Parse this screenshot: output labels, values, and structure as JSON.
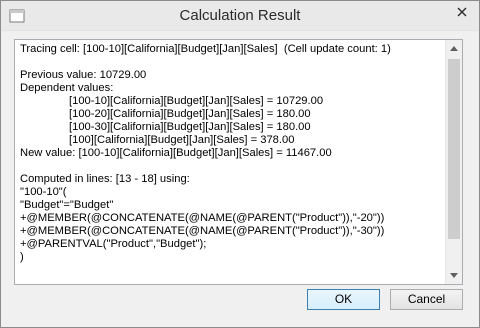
{
  "window": {
    "title": "Calculation Result"
  },
  "content": {
    "lines": [
      {
        "text": "Tracing cell: [100-10][California][Budget][Jan][Sales]  (Cell update count: 1)",
        "indent": false
      },
      {
        "text": "",
        "indent": false
      },
      {
        "text": "Previous value: 10729.00",
        "indent": false
      },
      {
        "text": "Dependent values:",
        "indent": false
      },
      {
        "text": "[100-10][California][Budget][Jan][Sales] = 10729.00",
        "indent": true
      },
      {
        "text": "[100-20][California][Budget][Jan][Sales] = 180.00",
        "indent": true
      },
      {
        "text": "[100-30][California][Budget][Jan][Sales] = 180.00",
        "indent": true
      },
      {
        "text": "[100][California][Budget][Jan][Sales] = 378.00",
        "indent": true
      },
      {
        "text": "New value: [100-10][California][Budget][Jan][Sales] = 11467.00",
        "indent": false
      },
      {
        "text": "",
        "indent": false
      },
      {
        "text": "Computed in lines: [13 - 18] using:",
        "indent": false
      },
      {
        "text": "\"100-10\"(",
        "indent": false
      },
      {
        "text": "\"Budget\"=\"Budget\"",
        "indent": false
      },
      {
        "text": "+@MEMBER(@CONCATENATE(@NAME(@PARENT(\"Product\")),\"-20\"))",
        "indent": false
      },
      {
        "text": "+@MEMBER(@CONCATENATE(@NAME(@PARENT(\"Product\")),\"-30\"))",
        "indent": false
      },
      {
        "text": "+@PARENTVAL(\"Product\",\"Budget\");",
        "indent": false
      },
      {
        "text": ")",
        "indent": false
      }
    ]
  },
  "buttons": {
    "ok_label": "OK",
    "cancel_label": "Cancel"
  }
}
